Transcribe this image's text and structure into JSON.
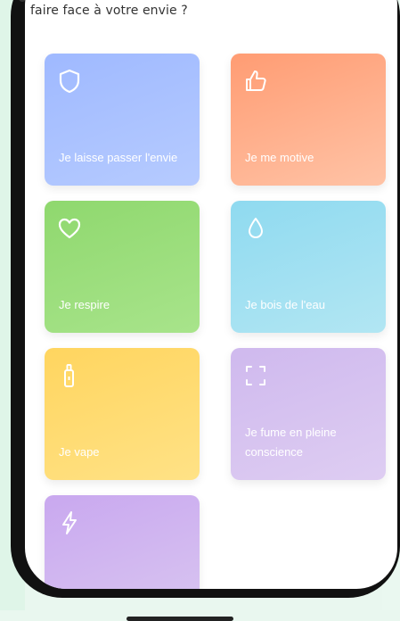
{
  "header": {
    "question": "faire face à votre envie ?"
  },
  "cards": [
    {
      "label": "Je laisse passer l'envie",
      "icon": "shield-icon",
      "color": "#a6beff"
    },
    {
      "label": "Je me motive",
      "icon": "thumbs-up-icon",
      "color": "#ffaa82"
    },
    {
      "label": "Je respire",
      "icon": "heart-icon",
      "color": "#99dd77"
    },
    {
      "label": "Je bois de l'eau",
      "icon": "water-drop-icon",
      "color": "#98dcf0"
    },
    {
      "label": "Je vape",
      "icon": "vape-icon",
      "color": "#ffd864"
    },
    {
      "label": "Je fume en pleine conscience",
      "icon": "focus-frame-icon",
      "color": "#d3bff0"
    },
    {
      "label": "",
      "icon": "lightning-icon",
      "color": "#cdaef0"
    }
  ]
}
